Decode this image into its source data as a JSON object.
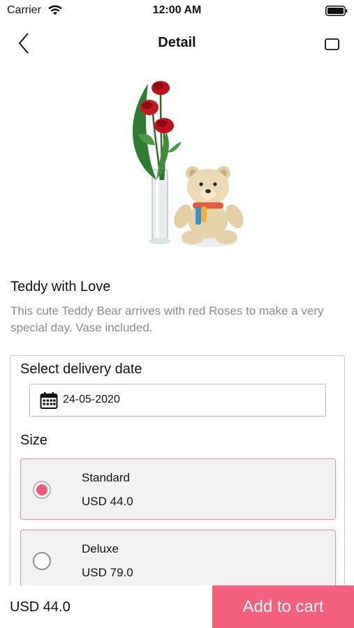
{
  "status_bar": {
    "carrier": "Carrier",
    "time": "12:00 AM",
    "icons": [
      "wifi-icon",
      "battery-icon"
    ]
  },
  "nav": {
    "title": "Detail",
    "back_icon": "chevron-left-icon",
    "action_icon": "square-icon"
  },
  "product": {
    "image": "teddy-bear-with-red-roses-vase",
    "title": "Teddy with Love",
    "description": "This cute Teddy Bear arrives with  red Roses to make a very special day. Vase included."
  },
  "delivery": {
    "label": "Select delivery date",
    "date": "24-05-2020",
    "icon": "calendar-icon"
  },
  "size": {
    "label": "Size",
    "options": [
      {
        "name": "Standard",
        "price": "USD 44.0",
        "selected": true
      },
      {
        "name": "Deluxe",
        "price": "USD 79.0",
        "selected": false
      }
    ]
  },
  "footer": {
    "total": "USD 44.0",
    "cta": "Add to cart"
  },
  "colors": {
    "accent": "#f4607d",
    "selected_radio": "#f0597a",
    "option_border": "#f08a99",
    "muted_text": "#8a8a8a"
  }
}
